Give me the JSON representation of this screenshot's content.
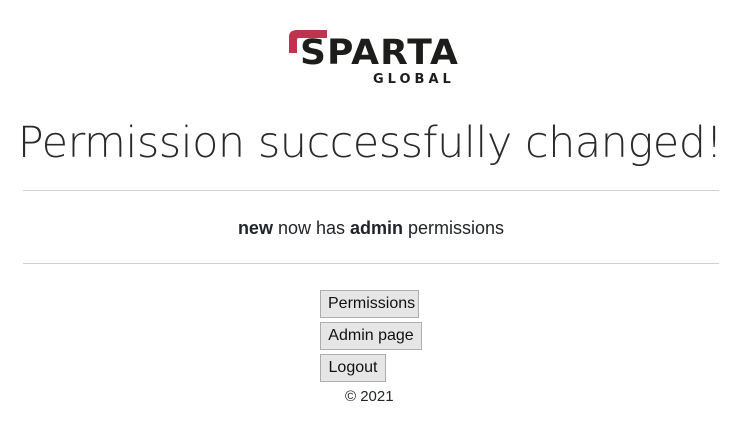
{
  "logo": {
    "word": "SPARTA",
    "sub": "GLOBAL",
    "accent_color": "#c0324e"
  },
  "heading": "Permission successfully changed!",
  "message": {
    "username": "new",
    "mid_text": " now has ",
    "role": "admin",
    "tail_text": " permissions"
  },
  "buttons": {
    "permissions": "Permissions",
    "admin_page": "Admin page",
    "logout": "Logout"
  },
  "footer": "© 2021"
}
